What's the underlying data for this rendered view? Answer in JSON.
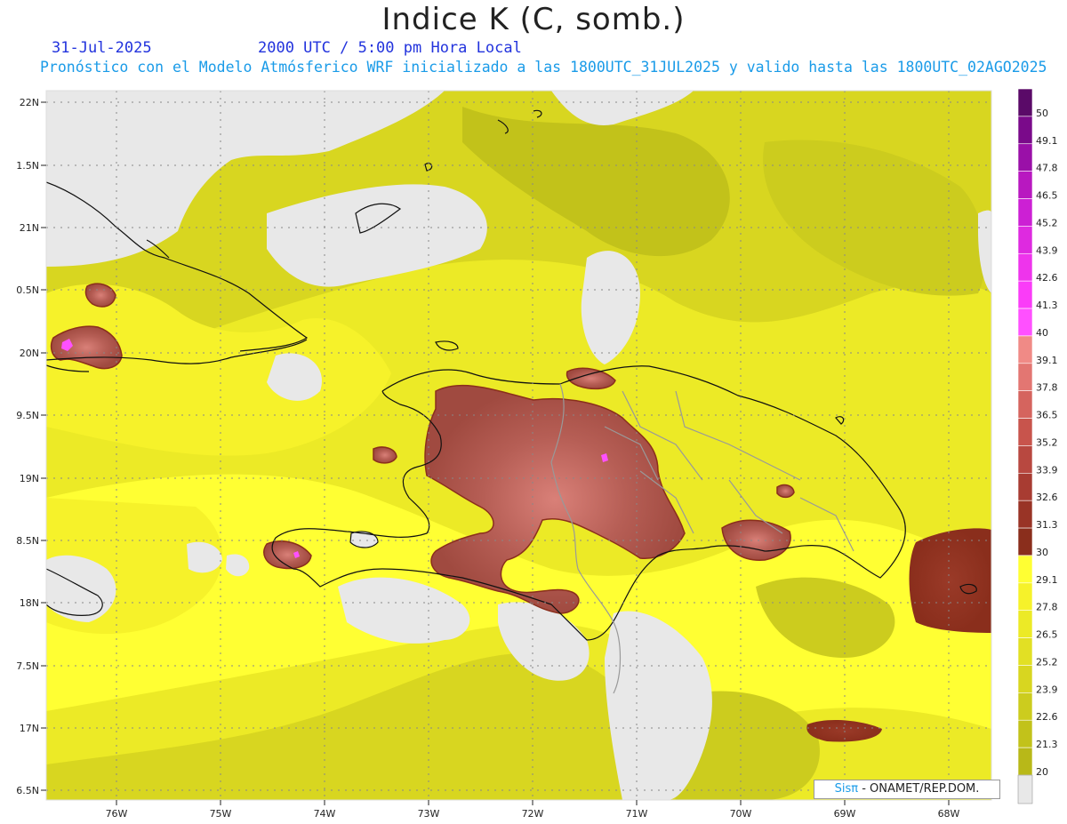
{
  "header": {
    "title": "Indice K (C, somb.)",
    "date": "31-Jul-2025",
    "time": "2000 UTC / 5:00 pm Hora Local",
    "forecast_line": "Pronóstico con el Modelo Atmósferico WRF inicializado a las 1800UTC_31JUL2025 y valido hasta las  1800UTC_02AGO2025"
  },
  "map": {
    "lat_labels": [
      "22N",
      "1.5N",
      "21N",
      "0.5N",
      "20N",
      "9.5N",
      "19N",
      "8.5N",
      "18N",
      "7.5N",
      "17N",
      "6.5N"
    ],
    "lon_labels": [
      "76W",
      "75W",
      "74W",
      "73W",
      "72W",
      "71W",
      "70W",
      "69W",
      "68W"
    ]
  },
  "colorbar": {
    "labels": [
      "50",
      "49.1",
      "47.8",
      "46.5",
      "45.2",
      "43.9",
      "42.6",
      "41.3",
      "40",
      "39.1",
      "37.8",
      "36.5",
      "35.2",
      "33.9",
      "32.6",
      "31.3",
      "30",
      "29.1",
      "27.8",
      "26.5",
      "25.2",
      "23.9",
      "22.6",
      "21.3",
      "20"
    ],
    "colors": [
      "#5a0a68",
      "#7a0a8a",
      "#9a10a8",
      "#b818c0",
      "#cc20d4",
      "#de2ae0",
      "#ee34ec",
      "#fa3cf8",
      "#ff50ff",
      "#f08a86",
      "#e37672",
      "#d5645e",
      "#c8544c",
      "#b84840",
      "#a83c32",
      "#993426",
      "#8a2e1c",
      "#ffff33",
      "#f6f22a",
      "#ecea26",
      "#e2e024",
      "#d8d620",
      "#cccc1e",
      "#c2c21a",
      "#b8b818"
    ],
    "below_color": "#e8e8e8"
  },
  "credit": {
    "sis": "Sisπ",
    "org": " - ONAMET/REP.DOM."
  }
}
